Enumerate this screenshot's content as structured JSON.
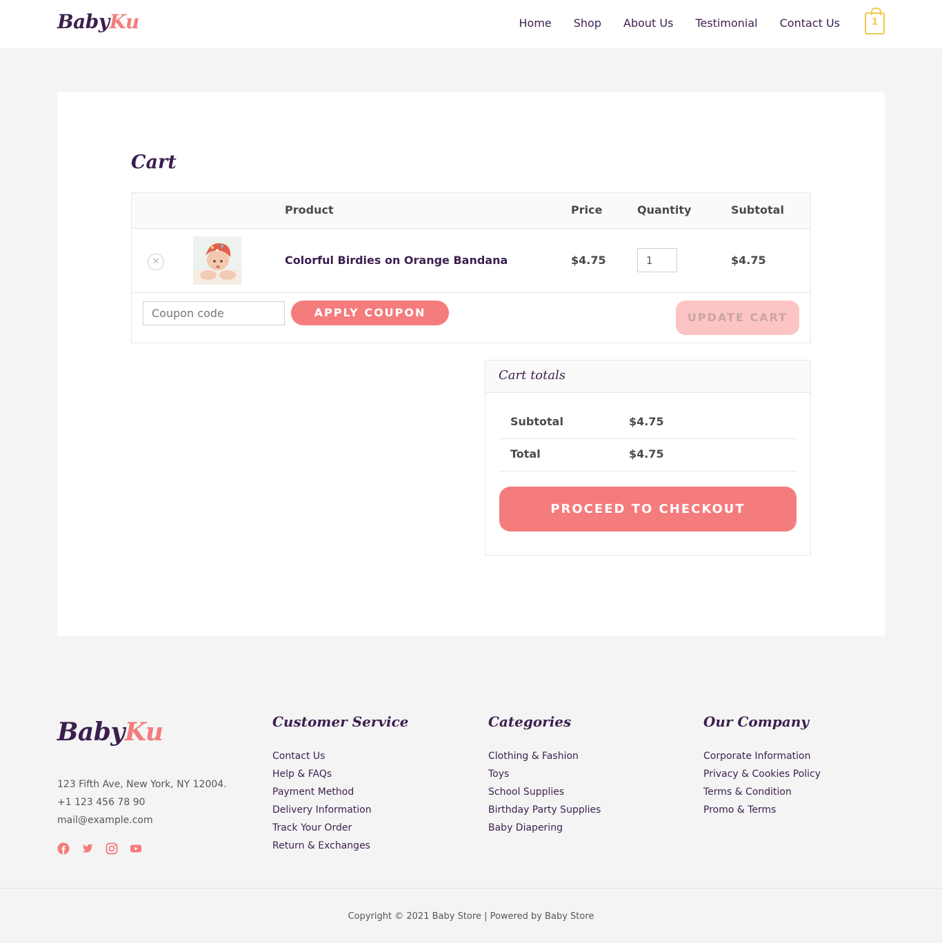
{
  "brand": {
    "part1": "Baby",
    "part2": "Ku",
    "primary": "#3b1f4f",
    "accent": "#f47c7c"
  },
  "nav": {
    "items": [
      "Home",
      "Shop",
      "About Us",
      "Testimonial",
      "Contact Us"
    ],
    "cart_count": "1",
    "cart_icon": "shopping-bag-icon"
  },
  "page": {
    "title": "Cart"
  },
  "cart": {
    "headers": {
      "product": "Product",
      "price": "Price",
      "quantity": "Quantity",
      "subtotal": "Subtotal"
    },
    "items": [
      {
        "name": "Colorful Birdies on Orange Bandana",
        "price": "$4.75",
        "quantity": "1",
        "subtotal": "$4.75",
        "remove_icon": "close-circle-icon"
      }
    ],
    "coupon_placeholder": "Coupon code",
    "apply_label": "APPLY COUPON",
    "update_label": "UPDATE CART"
  },
  "totals": {
    "title": "Cart totals",
    "subtotal_label": "Subtotal",
    "subtotal_value": "$4.75",
    "total_label": "Total",
    "total_value": "$4.75",
    "checkout_label": "PROCEED TO CHECKOUT"
  },
  "footer": {
    "address": "123 Fifth Ave, New York, NY 12004.",
    "phone": "+1 123 456 78 90",
    "email": "mail@example.com",
    "social_icons": [
      "facebook-icon",
      "twitter-icon",
      "instagram-icon",
      "youtube-icon"
    ],
    "columns": [
      {
        "title": "Customer Service",
        "links": [
          "Contact Us",
          "Help & FAQs",
          "Payment Method",
          "Delivery Information",
          "Track Your Order",
          "Return & Exchanges"
        ]
      },
      {
        "title": "Categories",
        "links": [
          "Clothing & Fashion",
          "Toys",
          "School Supplies",
          "Birthday Party Supplies",
          "Baby Diapering"
        ]
      },
      {
        "title": "Our Company",
        "links": [
          "Corporate Information",
          "Privacy & Cookies Policy",
          "Terms & Condition",
          "Promo & Terms"
        ]
      }
    ],
    "copyright": "Copyright © 2021 Baby Store | Powered by Baby Store"
  }
}
